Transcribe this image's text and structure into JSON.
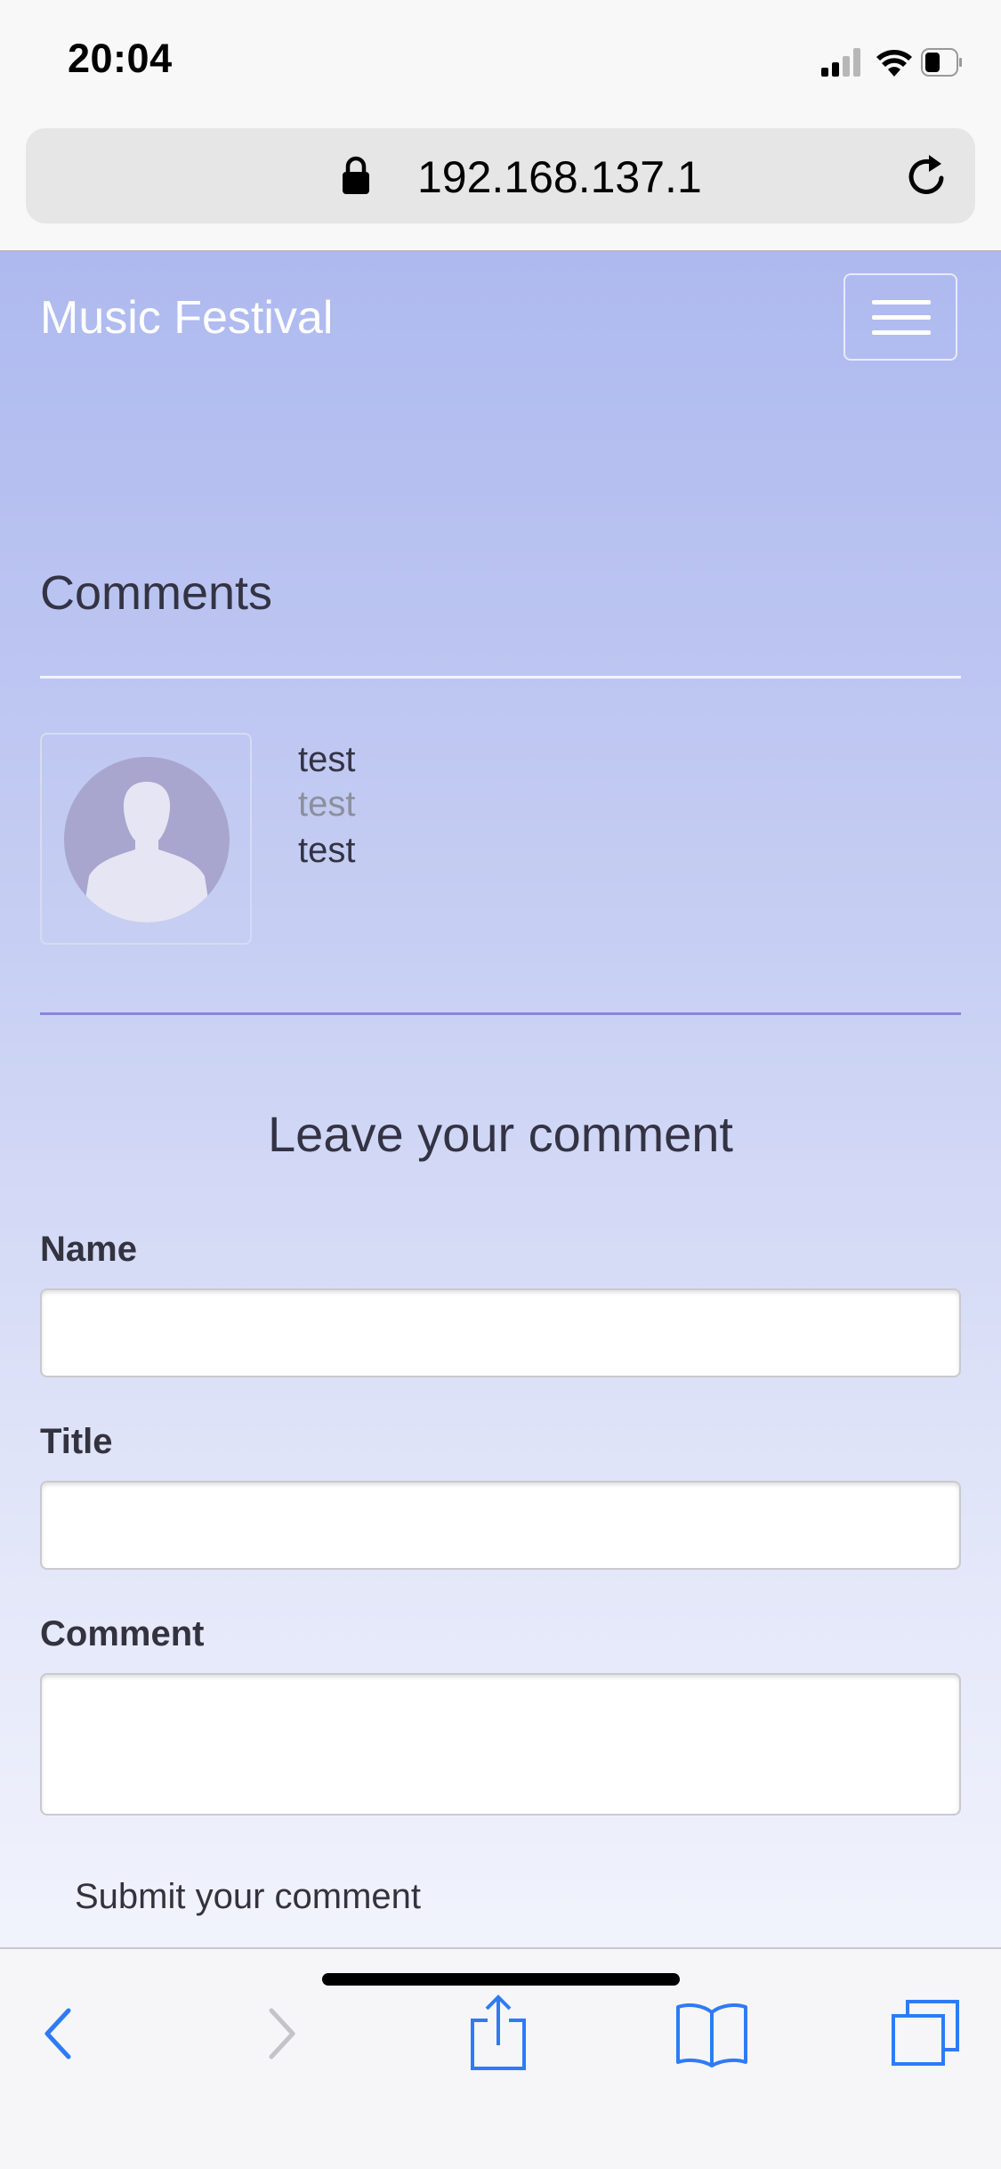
{
  "status_bar": {
    "time": "20:04",
    "icons": [
      "cellular-signal-icon",
      "wifi-icon",
      "battery-icon"
    ]
  },
  "address_bar": {
    "url": "192.168.137.1",
    "lock_icon": "lock-icon",
    "reload_icon": "reload-icon"
  },
  "navbar": {
    "brand": "Music Festival",
    "menu_icon": "hamburger-menu-icon"
  },
  "comments_section": {
    "title": "Comments",
    "items": [
      {
        "avatar_icon": "user-silhouette-icon",
        "name": "test",
        "title": "test",
        "body": "test"
      }
    ]
  },
  "comment_form": {
    "title": "Leave your comment",
    "name_label": "Name",
    "name_value": "",
    "title_label": "Title",
    "title_value": "",
    "comment_label": "Comment",
    "comment_value": "",
    "submit_label": "Submit your comment"
  },
  "toolbar": {
    "items": [
      "back-icon",
      "forward-icon",
      "share-icon",
      "bookmarks-icon",
      "tabs-icon"
    ]
  },
  "colors": {
    "nav_background": "#aeb9ef",
    "accent_divider": "#8d82e2",
    "ios_blue": "#2f7bf5"
  }
}
